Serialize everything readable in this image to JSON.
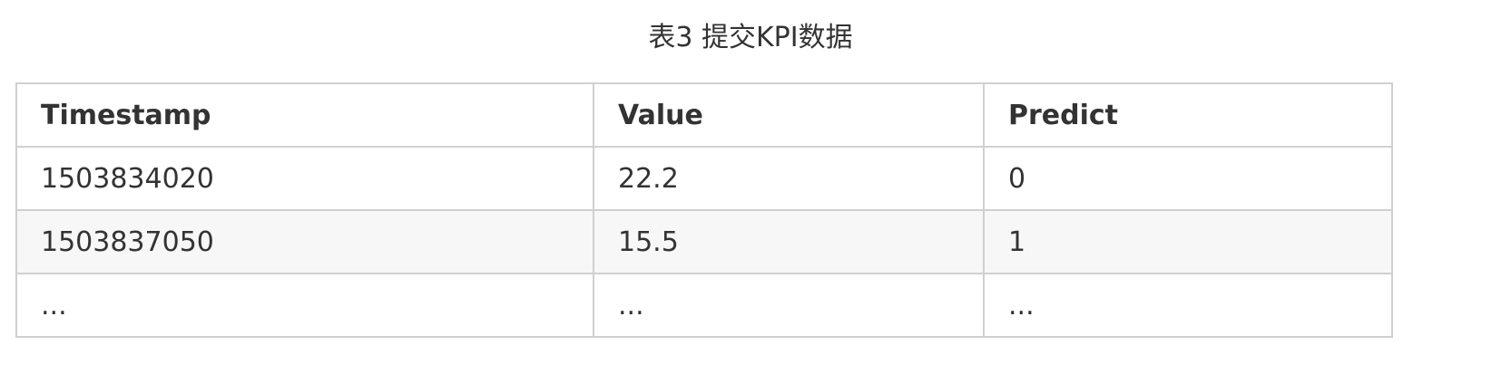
{
  "caption": "表3 提交KPI数据",
  "table": {
    "headers": [
      "Timestamp",
      "Value",
      "Predict"
    ],
    "rows": [
      [
        "1503834020",
        "22.2",
        "0"
      ],
      [
        "1503837050",
        "15.5",
        "1"
      ],
      [
        "...",
        "...",
        "..."
      ]
    ]
  }
}
